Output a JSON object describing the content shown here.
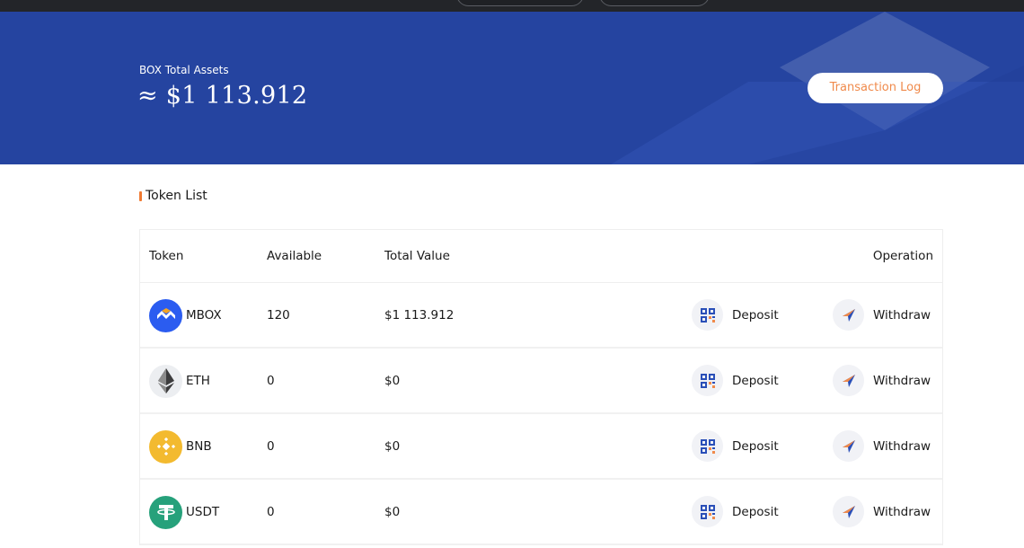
{
  "header": {
    "assets_label": "BOX Total Assets",
    "total_assets": "≈ $1 113.912",
    "transaction_log_label": "Transaction Log"
  },
  "section": {
    "title": "Token List"
  },
  "table": {
    "columns": {
      "token": "Token",
      "available": "Available",
      "total_value": "Total Value",
      "operation": "Operation"
    },
    "rows": [
      {
        "token": "MBOX",
        "available": "120",
        "total_value": "$1 113.912",
        "icon": "mbox-icon",
        "deposit": "Deposit",
        "withdraw": "Withdraw"
      },
      {
        "token": "ETH",
        "available": "0",
        "total_value": "$0",
        "icon": "eth-icon",
        "deposit": "Deposit",
        "withdraw": "Withdraw"
      },
      {
        "token": "BNB",
        "available": "0",
        "total_value": "$0",
        "icon": "bnb-icon",
        "deposit": "Deposit",
        "withdraw": "Withdraw"
      },
      {
        "token": "USDT",
        "available": "0",
        "total_value": "$0",
        "icon": "usdt-icon",
        "deposit": "Deposit",
        "withdraw": "Withdraw"
      }
    ]
  },
  "colors": {
    "hero_bg": "#2544a0",
    "accent_orange": "#f08a4b",
    "mbox": "#2b5cf0",
    "bnb": "#f3ba2f",
    "usdt": "#26a17b"
  }
}
